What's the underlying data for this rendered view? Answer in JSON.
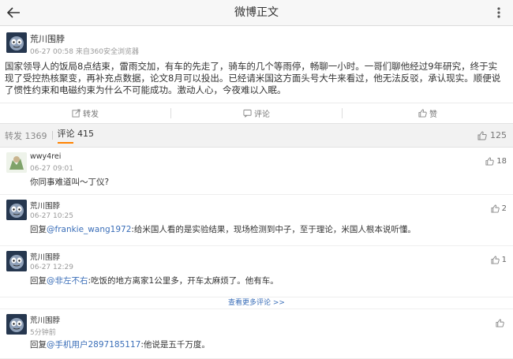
{
  "header": {
    "title": "微博正文"
  },
  "post": {
    "author": "荒川围脖",
    "time": "06-27 00:58",
    "source": "来自360安全浏览器",
    "text": "国家领导人的饭局8点结束，雷雨交加，有车的先走了，骑车的几个等雨停，畅聊一小时。一哥们聊他经过9年研究，终于实现了受控热核聚变，再补充点数据，论文8月可以投出。已经请米国这方面头号大牛来看过，他无法反驳，承认现实。顺便说了惯性约束和电磁约束为什么不可能成功。激动人心，今夜难以入眠。",
    "actions": {
      "repost": "转发",
      "comment": "评论",
      "like": "赞"
    }
  },
  "tabs": {
    "repost_label": "转发",
    "repost_count": "1369",
    "comment_label": "评论",
    "comment_count": "415",
    "like_count": "125"
  },
  "comments": [
    {
      "name": "wwy4rei",
      "time": "06-27 09:01",
      "text": "你同事难道叫～丁仪?",
      "likes": "18"
    },
    {
      "name": "荒川围脖",
      "time": "06-27 10:25",
      "reply_prefix": "回复",
      "mention": "@frankie_wang1972",
      "text": ":给米国人看的是实验结果，现场检测到中子，至于理论，米国人根本说听懂。",
      "likes": "2"
    },
    {
      "name": "荒川围脖",
      "time": "06-27 12:29",
      "reply_prefix": "回复",
      "mention": "@非左不右",
      "text": ":吃饭的地方离家1公里多，开车太麻烦了。他有车。",
      "likes": "1"
    },
    {
      "name": "荒川围脖",
      "time": "5分钟前",
      "reply_prefix": "回复",
      "mention": "@手机用户2897185117",
      "text": ":他说是五千万度。",
      "likes": ""
    }
  ],
  "more_replies": "查看更多评论 >>"
}
